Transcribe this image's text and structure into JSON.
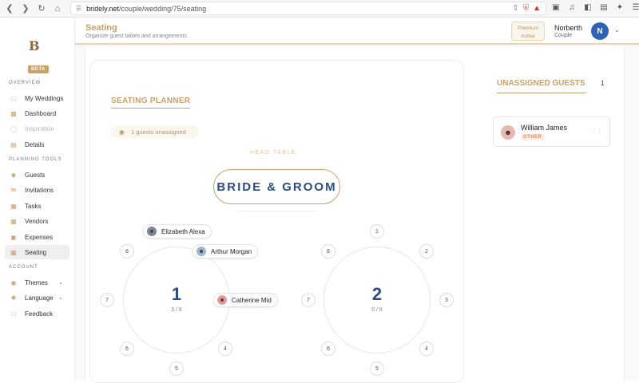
{
  "browser": {
    "url_host": "bridely.net",
    "url_path": "/couple/wedding/75/seating"
  },
  "sidebar": {
    "badge": "BETA",
    "sections": {
      "overview": "OVERVIEW",
      "planning": "PLANNING TOOLS",
      "account": "ACCOUNT"
    },
    "items": {
      "my_weddings": "My Weddings",
      "dashboard": "Dashboard",
      "inspiration": "Inspiration",
      "details": "Details",
      "guests": "Guests",
      "invitations": "Invitations",
      "tasks": "Tasks",
      "vendors": "Vendors",
      "expenses": "Expenses",
      "seating": "Seating",
      "themes": "Themes",
      "language": "Language",
      "feedback": "Feedback"
    }
  },
  "header": {
    "title": "Seating",
    "subtitle": "Organize guest tables and arrangements",
    "premium_line1": "Premium",
    "premium_line2": "Active",
    "user_name": "Norberth",
    "user_role": "Couple",
    "avatar_initial": "N"
  },
  "planner": {
    "title": "SEATING PLANNER",
    "unassigned_pill": "1 guests unassigned",
    "head_table_label": "HEAD TABLE",
    "head_table_name": "BRIDE & GROOM",
    "tables": [
      {
        "number": "1",
        "count": "3 / 8",
        "seats": [
          "8",
          "7",
          "6",
          "5",
          "4"
        ]
      },
      {
        "number": "2",
        "count": "0 / 8",
        "seats": [
          "1",
          "2",
          "3",
          "4",
          "5",
          "6",
          "7",
          "8"
        ]
      }
    ],
    "seated_guests": [
      "Elizabeth Alexa",
      "Arthur Morgan",
      "Catherine Mid"
    ]
  },
  "unassigned": {
    "title": "UNASSIGNED GUESTS",
    "count": "1",
    "guests": [
      {
        "name": "William James",
        "tag": "OTHER"
      }
    ]
  },
  "colors": {
    "accent_gold": "#c8a06a",
    "navy": "#2b4b8a",
    "avatar_blue": "#2f63b5"
  }
}
